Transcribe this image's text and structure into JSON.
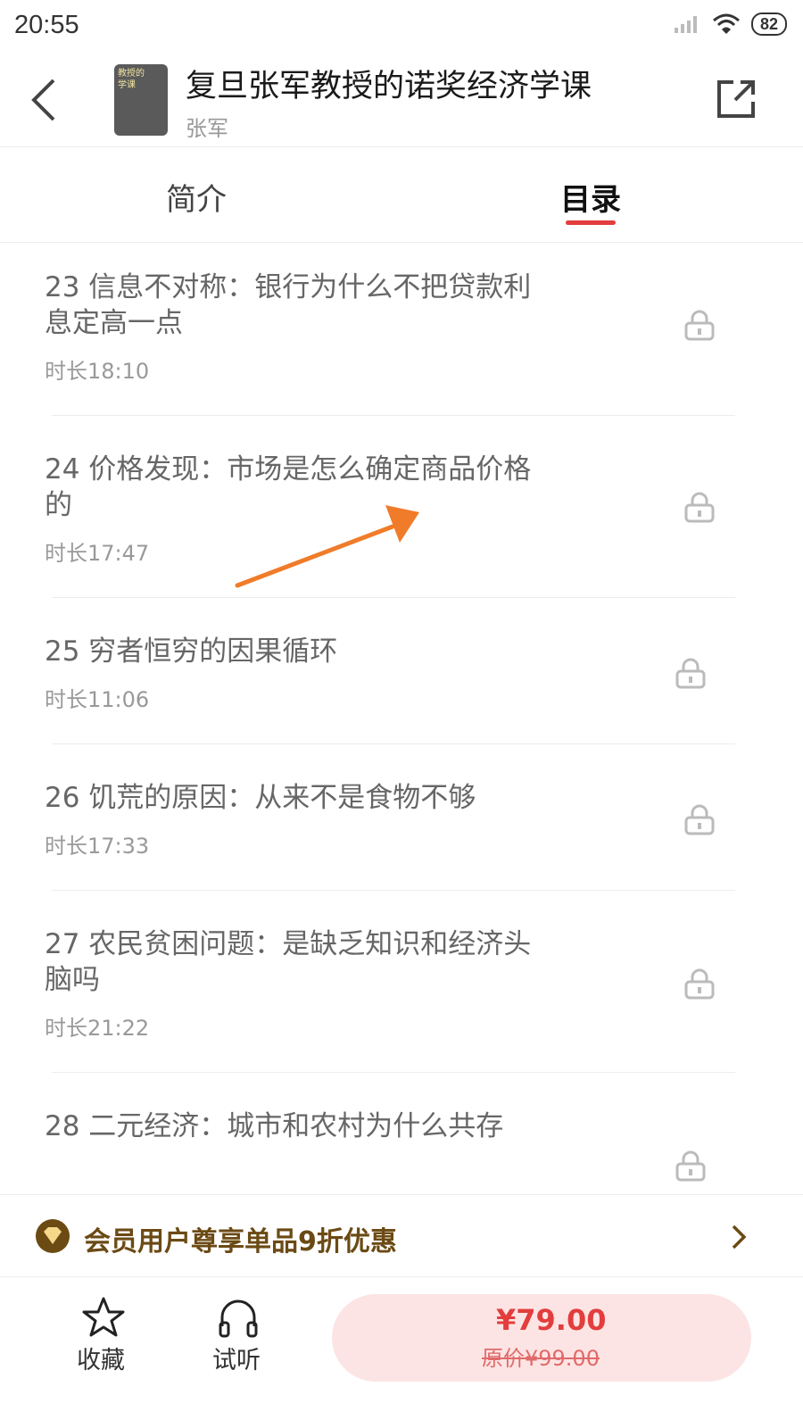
{
  "status_bar": {
    "time": "20:55",
    "battery": "82"
  },
  "header": {
    "title": "复旦张军教授的诺奖经济学课",
    "author": "张军",
    "cover_text": [
      "教授的",
      "学课"
    ]
  },
  "tabs": [
    {
      "label": "简介",
      "selected": false
    },
    {
      "label": "目录",
      "selected": true
    }
  ],
  "episodes": [
    {
      "title": "23 信息不对称：银行为什么不把贷款利息定高一点",
      "duration": "时长18:10",
      "locked": true
    },
    {
      "title": "24 价格发现：市场是怎么确定商品价格的",
      "duration": "时长17:47",
      "locked": true
    },
    {
      "title": "25 穷者恒穷的因果循环",
      "duration": "时长11:06",
      "locked": true
    },
    {
      "title": "26 饥荒的原因：从来不是食物不够",
      "duration": "时长17:33",
      "locked": true
    },
    {
      "title": "27 农民贫困问题：是缺乏知识和经济头脑吗",
      "duration": "时长21:22",
      "locked": true
    },
    {
      "title": "28 二元经济：城市和农村为什么共存",
      "duration": "",
      "locked": true
    }
  ],
  "member_promo": {
    "text": "会员用户尊享单品9折优惠"
  },
  "bottom_bar": {
    "favorite_label": "收藏",
    "listen_label": "试听",
    "price": "¥79.00",
    "original_price": "原价¥99.00"
  },
  "colors": {
    "accent": "#e33d3d",
    "member_gold": "#6b4a14",
    "annotation_arrow": "#f07c2a"
  }
}
